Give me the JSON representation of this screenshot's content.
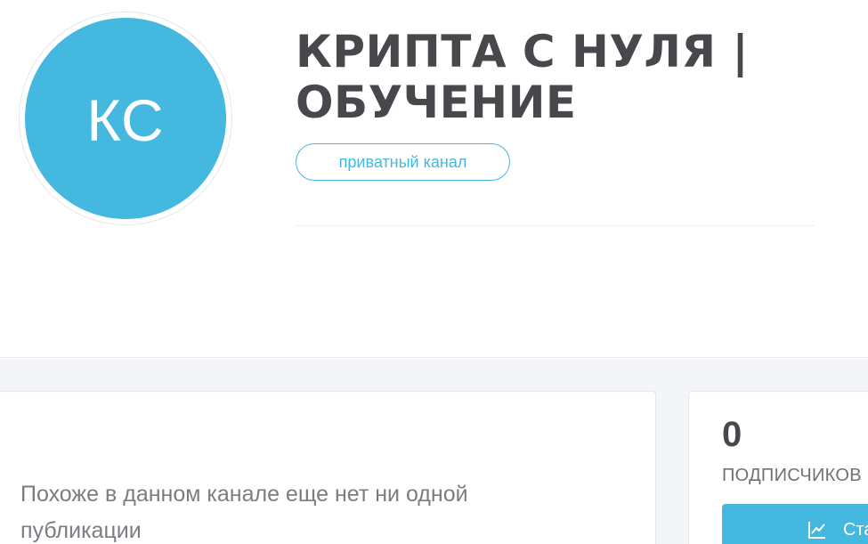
{
  "channel": {
    "avatar_initials": "КС",
    "title": "КРИПТА С НУЛЯ | ОБУЧЕНИЕ",
    "badge": "приватный канал"
  },
  "posts": {
    "empty_message": "Похоже в данном канале еще нет ни одной публикации"
  },
  "stats": {
    "subscribers_count": "0",
    "subscribers_label": "ПОДПИСЧИКОВ",
    "button_label": "Ста",
    "button_icon": "line-chart-icon"
  },
  "colors": {
    "accent": "#45b8df",
    "title_text": "#46484c",
    "background": "#f3f5f8"
  }
}
